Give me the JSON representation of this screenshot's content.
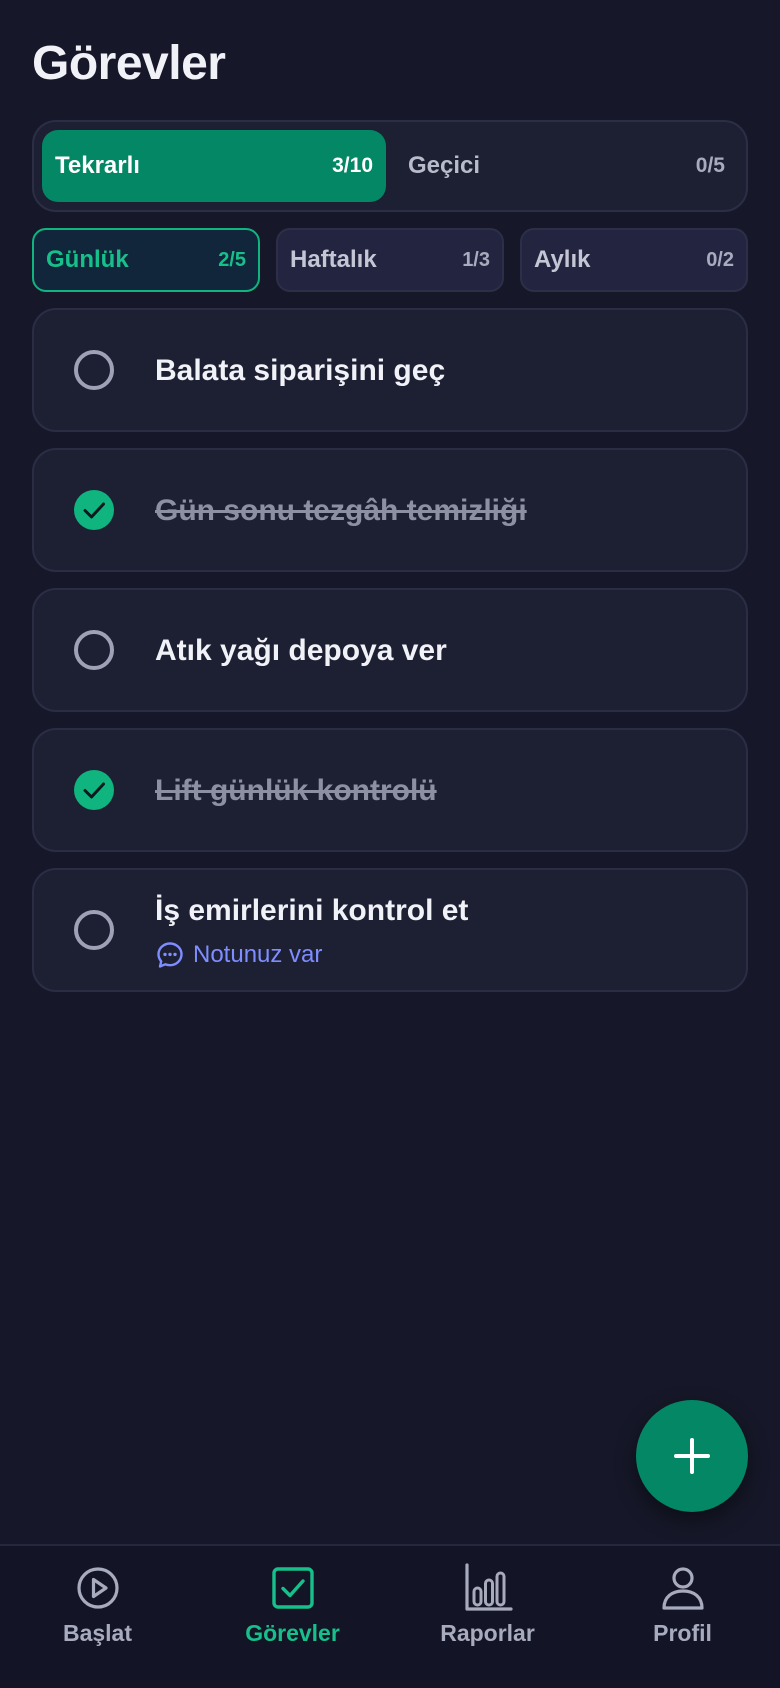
{
  "page": {
    "title": "Görevler"
  },
  "segment": {
    "active": {
      "label": "Tekrarlı",
      "count": "3/10"
    },
    "inactive": {
      "label": "Geçici",
      "count": "0/5"
    }
  },
  "subtabs": [
    {
      "label": "Günlük",
      "count": "2/5",
      "active": true
    },
    {
      "label": "Haftalık",
      "count": "1/3",
      "active": false
    },
    {
      "label": "Aylık",
      "count": "0/2",
      "active": false
    }
  ],
  "tasks": [
    {
      "text": "Balata siparişini geç",
      "done": false
    },
    {
      "text": "Gün sonu tezgâh temizliği",
      "done": true
    },
    {
      "text": "Atık yağı depoya ver",
      "done": false
    },
    {
      "text": "Lift günlük kontrolü",
      "done": true
    },
    {
      "text": "İş emirlerini kontrol et",
      "done": false,
      "note": "Notunuz var"
    }
  ],
  "fab": {
    "icon": "plus-icon"
  },
  "bottom_nav": [
    {
      "label": "Başlat",
      "icon": "play-circle-icon",
      "active": false
    },
    {
      "label": "Görevler",
      "icon": "checkbox-icon",
      "active": true
    },
    {
      "label": "Raporlar",
      "icon": "bar-chart-icon",
      "active": false
    },
    {
      "label": "Profil",
      "icon": "user-icon",
      "active": false
    }
  ],
  "colors": {
    "background": "#161829",
    "card": "#1d1f33",
    "accent": "#038764",
    "accent_text": "#17c08b",
    "note": "#7e8dff"
  }
}
